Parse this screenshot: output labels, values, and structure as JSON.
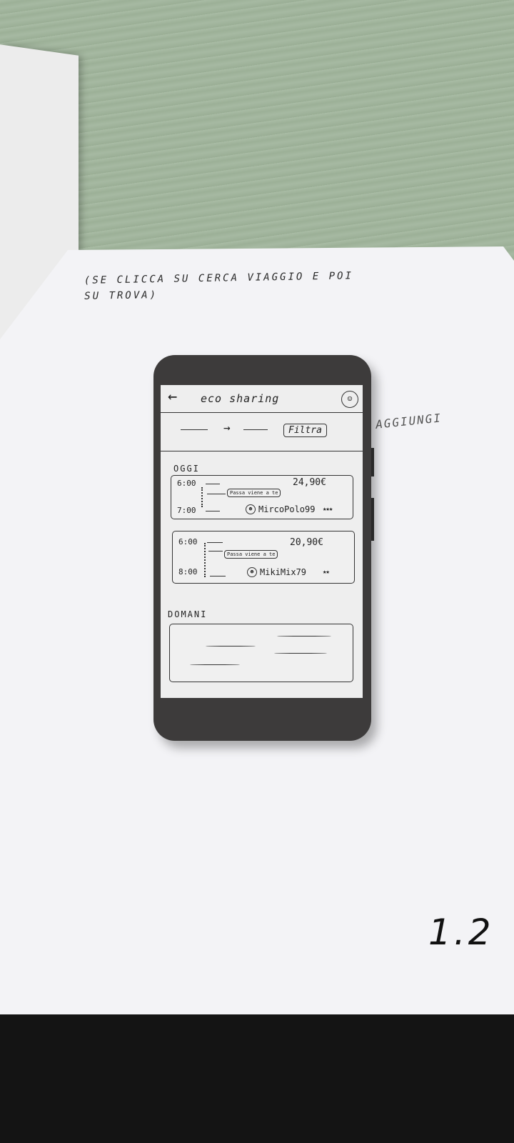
{
  "note": {
    "line1": "(SE CLICCA SU CERCA VIAGGIO E POI",
    "line2": "SU TROVA)"
  },
  "side_note": "AGGIUNGI",
  "page_number": "1.2",
  "app": {
    "title": "eco sharing",
    "back_icon": "arrow-left-icon",
    "menu_icon": "profile-icon"
  },
  "filter": {
    "label": "Filtra"
  },
  "sections": {
    "today": "OGGI",
    "tomorrow": "DOMANI"
  },
  "trips": [
    {
      "departure": "6:00",
      "arrival": "7:00",
      "price": "24,90€",
      "pass_label": "Passa viene a te",
      "driver": "MircoPolo99",
      "rating": "★★★"
    },
    {
      "departure": "6:00",
      "arrival": "8:00",
      "price": "20,90€",
      "pass_label": "Passa viene a te",
      "driver": "MikiMix79",
      "rating": "★★"
    }
  ]
}
